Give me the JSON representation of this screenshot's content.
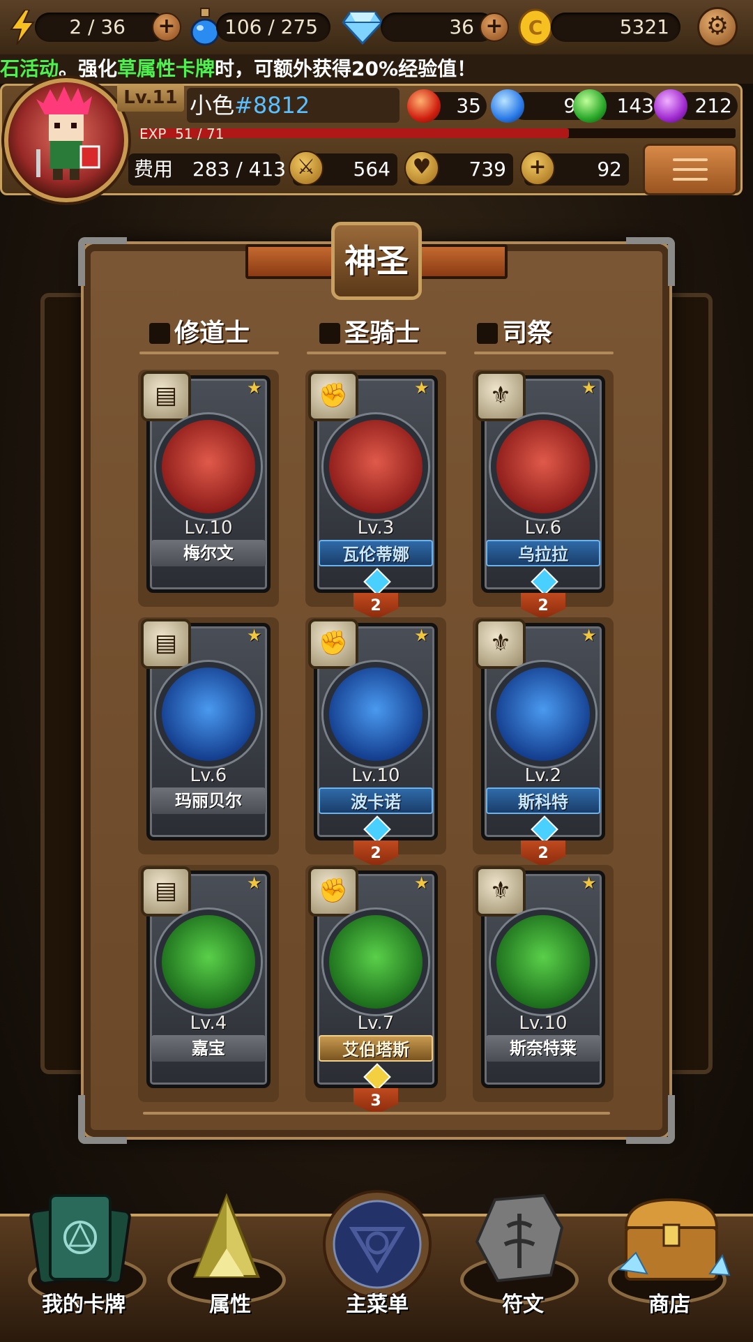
{
  "resources": {
    "energy": "2 / 36",
    "potion": "106 / 275",
    "diamond": "36",
    "gold": "5321"
  },
  "ticker": {
    "part1": "石活动",
    "part2": "。强化",
    "part3": "草属性卡牌",
    "part4": "时，可额外获得20%经验值！"
  },
  "player": {
    "level": "Lv.11",
    "name": "小色",
    "tag": "#8812",
    "exp_label": "EXP",
    "exp_value": "51 / 71",
    "exp_progress": 0.72,
    "elements": {
      "fire": "35",
      "water": "96",
      "grass": "143",
      "dark": "212"
    },
    "cost_label": "费用",
    "cost_value": "283 / 413",
    "attack": "564",
    "defense": "739",
    "heal": "92"
  },
  "board": {
    "title": "神圣",
    "columns": [
      {
        "label": "修道士"
      },
      {
        "label": "圣骑士"
      },
      {
        "label": "司祭"
      }
    ],
    "cards": [
      {
        "level": "Lv.10",
        "name": "梅尔文",
        "frame": "gray",
        "count": ""
      },
      {
        "level": "Lv.3",
        "name": "瓦伦蒂娜",
        "frame": "blue",
        "count": "2"
      },
      {
        "level": "Lv.6",
        "name": "乌拉拉",
        "frame": "blue",
        "count": "2"
      },
      {
        "level": "Lv.6",
        "name": "玛丽贝尔",
        "frame": "gray",
        "count": ""
      },
      {
        "level": "Lv.10",
        "name": "波卡诺",
        "frame": "blue",
        "count": "2"
      },
      {
        "level": "Lv.2",
        "name": "斯科特",
        "frame": "blue",
        "count": "2"
      },
      {
        "level": "Lv.4",
        "name": "嘉宝",
        "frame": "gray",
        "count": ""
      },
      {
        "level": "Lv.7",
        "name": "艾伯塔斯",
        "frame": "gold",
        "count": "3"
      },
      {
        "level": "Lv.10",
        "name": "斯奈特莱",
        "frame": "gray",
        "count": ""
      }
    ]
  },
  "nav": [
    {
      "label": "我的卡牌",
      "icon": "card-deck-icon"
    },
    {
      "label": "属性",
      "icon": "tri-crystal-icon"
    },
    {
      "label": "主菜单",
      "icon": "main-emblem-icon"
    },
    {
      "label": "符文",
      "icon": "rune-stone-icon"
    },
    {
      "label": "商店",
      "icon": "treasure-chest-icon"
    }
  ],
  "colors": {
    "ticker_highlight": "#4ef24e",
    "player_tag": "#5ac0ff",
    "exp_fill": "#b01818",
    "count_tag": "#c04a1e"
  }
}
